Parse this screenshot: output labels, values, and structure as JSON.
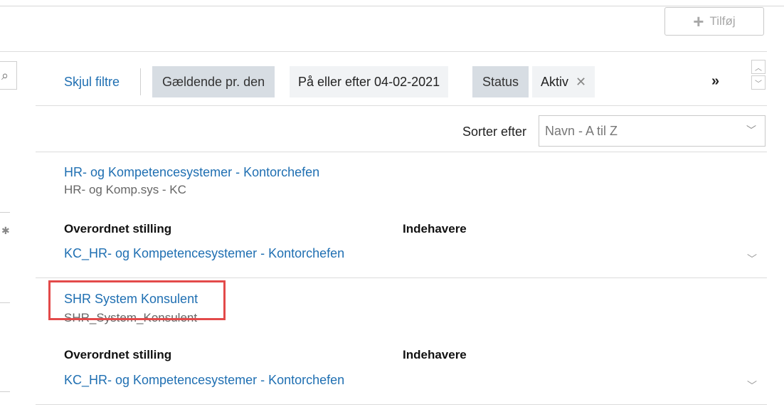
{
  "toolbar": {
    "add_label": "Tilføj"
  },
  "filter": {
    "hide_label": "Skjul filtre",
    "chips": [
      {
        "key": "Gældende pr. den",
        "value": "På eller efter 04-02-2021",
        "removable": false
      },
      {
        "key": "Status",
        "value": "Aktiv",
        "removable": true
      }
    ],
    "more_glyph": "»"
  },
  "sort": {
    "label": "Sorter efter",
    "selected": "Navn - A til Z"
  },
  "positions": [
    {
      "title": "HR- og Kompetencesystemer - Kontorchefen",
      "code": "HR- og Komp.sys - KC",
      "parent_header": "Overordnet stilling",
      "holders_header": "Indehavere",
      "parent": "KC_HR- og Kompetencesystemer - Kontorchefen"
    },
    {
      "title": "SHR System Konsulent",
      "code": "SHR_System_Konsulent",
      "parent_header": "Overordnet stilling",
      "holders_header": "Indehavere",
      "parent": "KC_HR- og Kompetencesystemer - Kontorchefen",
      "highlighted": true
    }
  ],
  "colors": {
    "link": "#1f6fb2",
    "chip_key_bg": "#d7dde3",
    "chip_value_bg": "#f1f3f5",
    "highlight": "#e34a4a"
  }
}
